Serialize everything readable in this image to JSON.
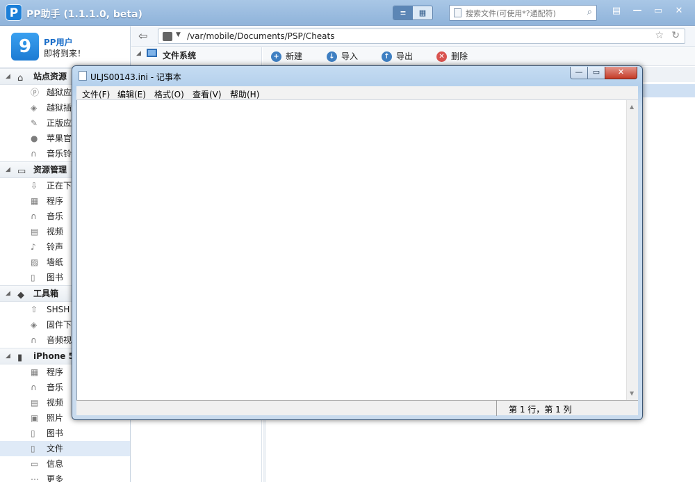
{
  "app": {
    "logo_letter": "P",
    "title": "PP助手 (1.1.1.0, beta)",
    "view_list_icon": "≡",
    "view_grid_icon": "▦",
    "search_placeholder": "搜索文件(可使用*?通配符)",
    "controls": {
      "feedback": "▤",
      "minimize": "—",
      "maximize": "▭",
      "close": "✕"
    }
  },
  "user": {
    "avatar_letter": "9",
    "name": "PP用户",
    "welcome": "即将到来！"
  },
  "sidebar": {
    "sections": [
      {
        "title": "站点资源",
        "items": [
          "越狱应",
          "越狱插",
          "正版应",
          "苹果官",
          "音乐铃"
        ]
      },
      {
        "title": "资源管理",
        "items": [
          "正在下",
          "程序",
          "音乐",
          "视频",
          "铃声",
          "墙纸",
          "图书"
        ]
      },
      {
        "title": "工具箱",
        "items": [
          "SHSH",
          "固件下",
          "音频视"
        ]
      },
      {
        "title": "iPhone 5",
        "items": [
          "程序",
          "音乐",
          "视频",
          "照片",
          "图书",
          "文件",
          "信息",
          "更多"
        ]
      }
    ]
  },
  "address": {
    "path": "/var/mobile/Documents/PSP/Cheats"
  },
  "tree": {
    "root_label": "文件系统"
  },
  "toolbar": {
    "new_label": "新建",
    "import_label": "导入",
    "export_label": "导出",
    "delete_label": "删除"
  },
  "notepad": {
    "title": "ULJS00143.ini - 记事本",
    "menus": {
      "file": "文件(F)",
      "edit": "编辑(E)",
      "format": "格式(O)",
      "view": "查看(V)",
      "help": "帮助(H)"
    },
    "content": "",
    "status_position": "第 1 行，第 1 列"
  },
  "colors": {
    "accent": "#1b7fd8",
    "titlebar": "#a9c7e6",
    "selection": "#dfeaf7"
  }
}
